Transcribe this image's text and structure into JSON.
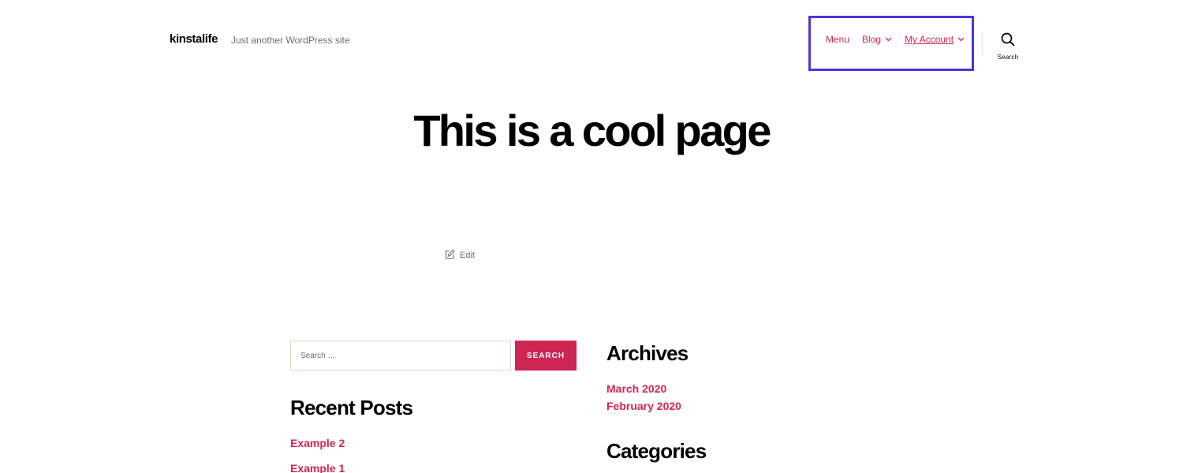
{
  "header": {
    "site_title": "kinstalife",
    "site_description": "Just another WordPress site",
    "nav": [
      {
        "label": "Menu",
        "has_dropdown": false,
        "icon": null
      },
      {
        "label": "Blog",
        "has_dropdown": true,
        "icon": "chevron-down-icon"
      },
      {
        "label": "My Account",
        "has_dropdown": true,
        "icon": "chevron-down-icon"
      }
    ],
    "search_toggle": {
      "label": "Search",
      "icon": "search-icon"
    }
  },
  "page": {
    "title": "This is a cool page",
    "edit_label": "Edit",
    "edit_icon": "edit-icon"
  },
  "search_widget": {
    "placeholder": "Search …",
    "value": "",
    "button_label": "SEARCH"
  },
  "recent_posts": {
    "heading": "Recent Posts",
    "items": [
      "Example 2",
      "Example 1"
    ]
  },
  "archives": {
    "heading": "Archives",
    "items": [
      "March 2020",
      "February 2020"
    ]
  },
  "categories": {
    "heading": "Categories"
  },
  "colors": {
    "accent": "#cd2653",
    "highlight_border": "#4f33db",
    "text": "#000000",
    "muted_text": "#6d6d6d"
  }
}
